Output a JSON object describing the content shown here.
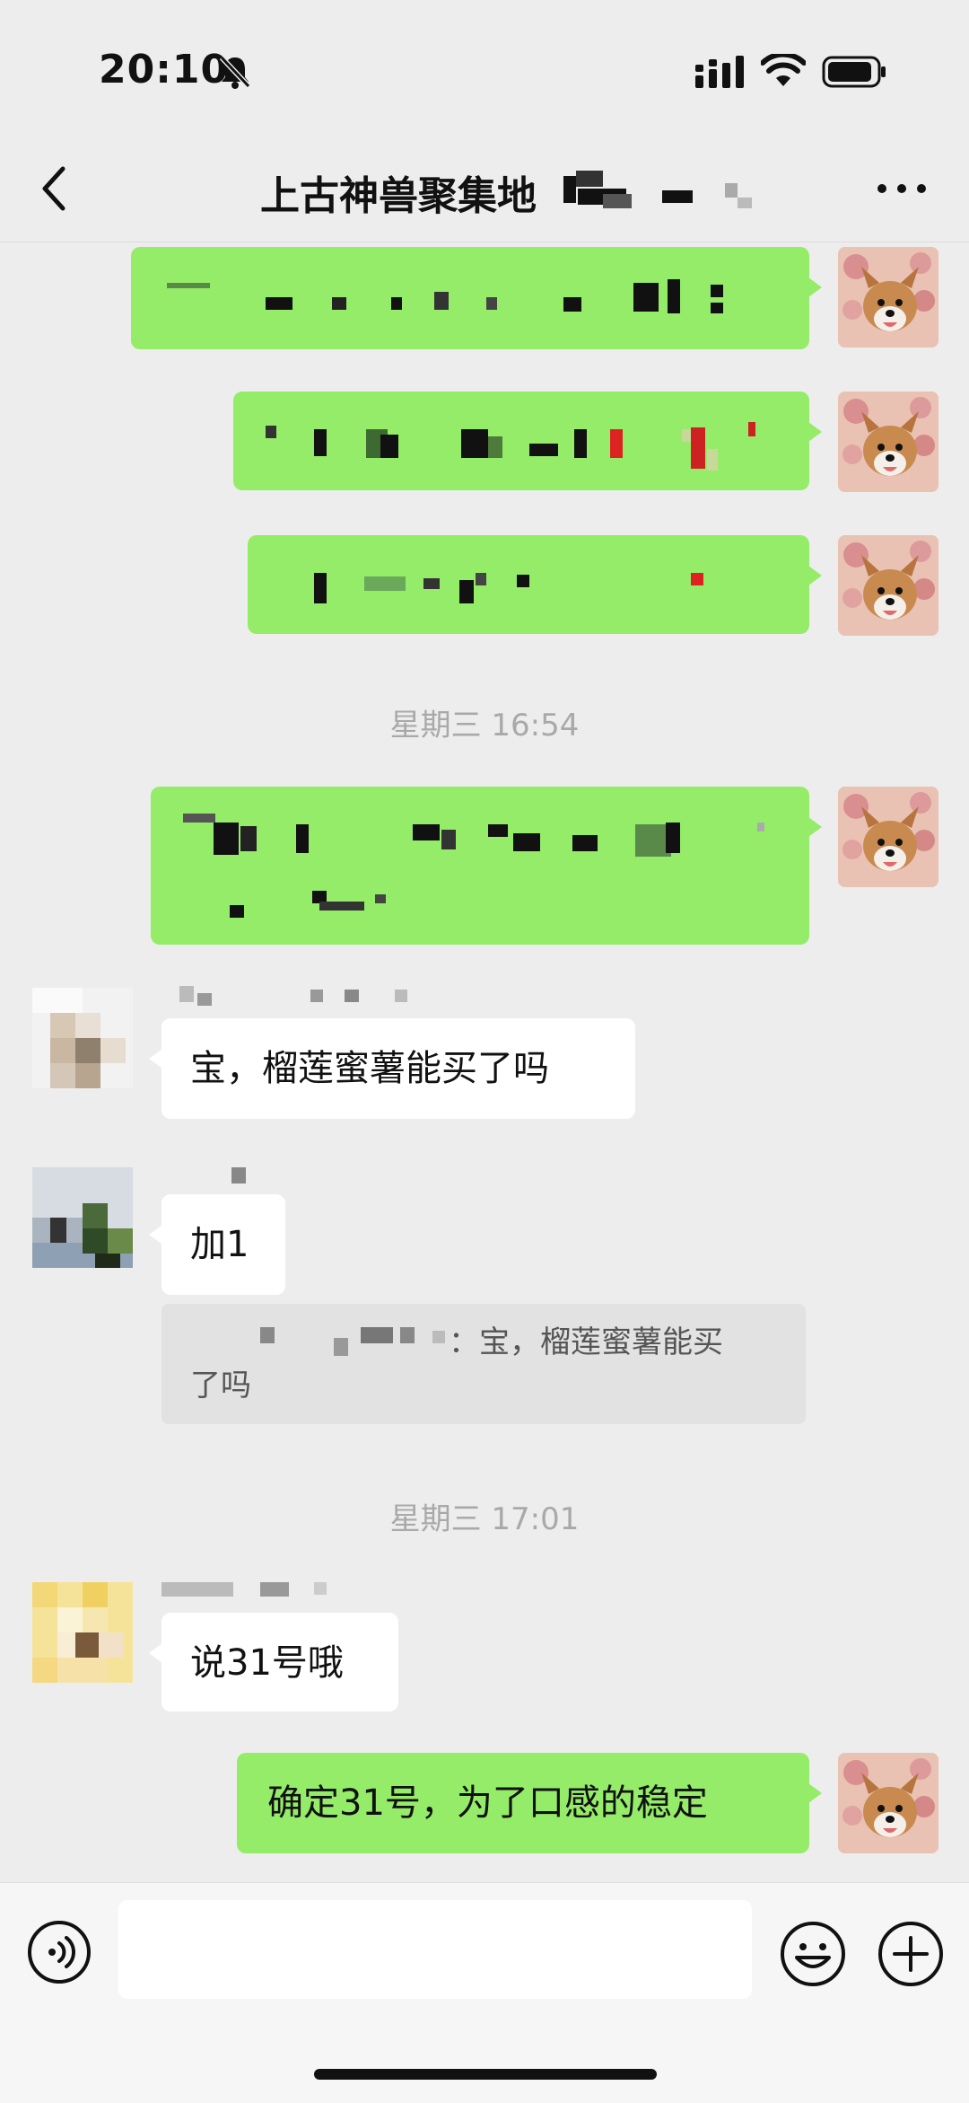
{
  "status_bar": {
    "time": "20:10",
    "icons": [
      "bell-muted-icon",
      "signal-icon",
      "wifi-icon",
      "battery-icon"
    ]
  },
  "nav": {
    "title": "上古神兽聚集地",
    "icons": [
      "back-chevron-icon",
      "more-dots-icon"
    ]
  },
  "messages": {
    "timestamp_1": "星期三 16:54",
    "incoming_1": "宝，榴莲蜜薯能买了吗",
    "incoming_2": "加1",
    "quote_suffix": "：宝，榴莲蜜薯能买",
    "quote_line2": "了吗",
    "timestamp_2": "星期三 17:01",
    "incoming_3": "说31号哦",
    "outgoing_last": "确定31号，为了口感的稳定"
  },
  "input_bar": {
    "value": "",
    "placeholder": "",
    "icons": [
      "voice-icon",
      "emoji-icon",
      "plus-icon"
    ]
  },
  "colors": {
    "background": "#ededed",
    "outgoing_bubble": "#95ec69",
    "incoming_bubble": "#ffffff",
    "timestamp_text": "#a9a9a9"
  }
}
